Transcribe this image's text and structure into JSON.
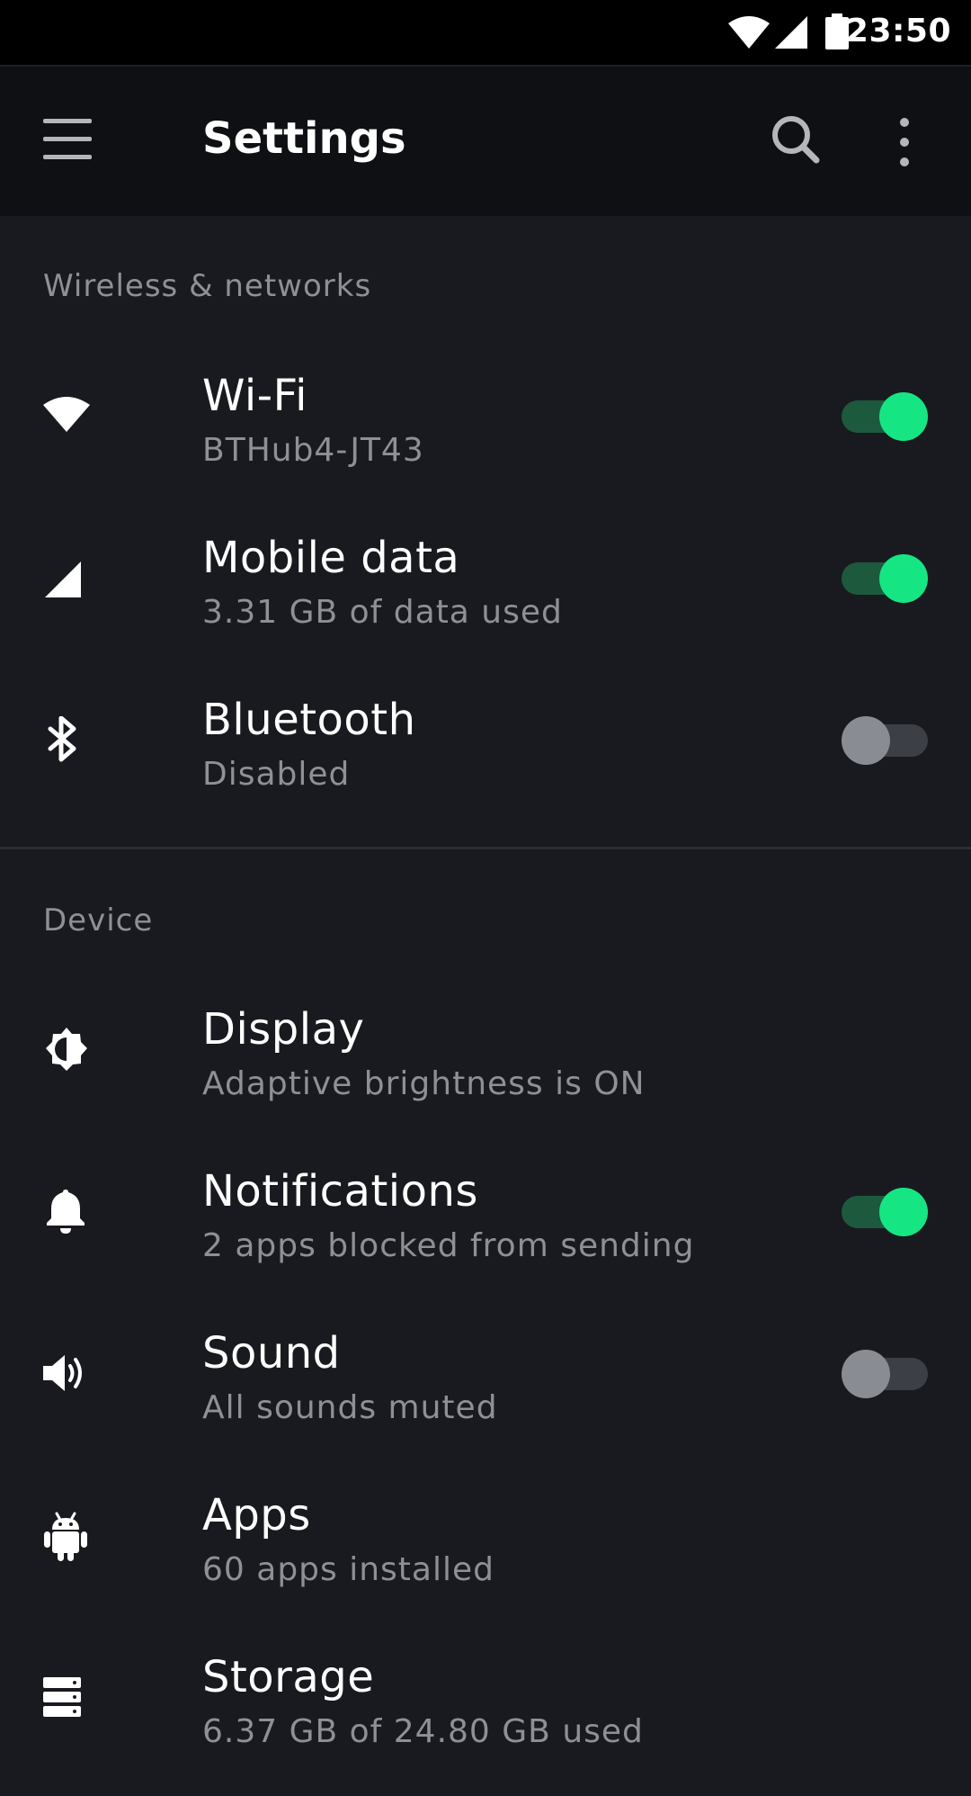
{
  "status_bar": {
    "time": "23:50",
    "icons": [
      "wifi-icon",
      "signal-icon",
      "battery-icon"
    ]
  },
  "app_bar": {
    "title": "Settings",
    "icons": [
      "menu-icon",
      "search-icon",
      "more-vert-icon"
    ]
  },
  "sections": [
    {
      "header": "Wireless & networks",
      "items": [
        {
          "icon": "wifi-icon",
          "title": "Wi-Fi",
          "subtitle": "BTHub4-JT43",
          "toggle": "on"
        },
        {
          "icon": "signal-icon",
          "title": "Mobile data",
          "subtitle": "3.31 GB of data used",
          "toggle": "on"
        },
        {
          "icon": "bluetooth-icon",
          "title": "Bluetooth",
          "subtitle": "Disabled",
          "toggle": "off"
        }
      ]
    },
    {
      "header": "Device",
      "items": [
        {
          "icon": "brightness-icon",
          "title": "Display",
          "subtitle": "Adaptive brightness is ON"
        },
        {
          "icon": "bell-icon",
          "title": "Notifications",
          "subtitle": "2 apps blocked from sending",
          "toggle": "on"
        },
        {
          "icon": "volume-icon",
          "title": "Sound",
          "subtitle": "All sounds muted",
          "toggle": "off"
        },
        {
          "icon": "android-icon",
          "title": "Apps",
          "subtitle": "60 apps installed"
        },
        {
          "icon": "storage-icon",
          "title": "Storage",
          "subtitle": "6.37 GB of 24.80 GB used"
        }
      ]
    }
  ],
  "colors": {
    "background": "#191a1f",
    "app_bar": "#0f1013",
    "accent": "#15e683",
    "accent_track": "#1d5a3d",
    "secondary_text": "#8e9096"
  }
}
